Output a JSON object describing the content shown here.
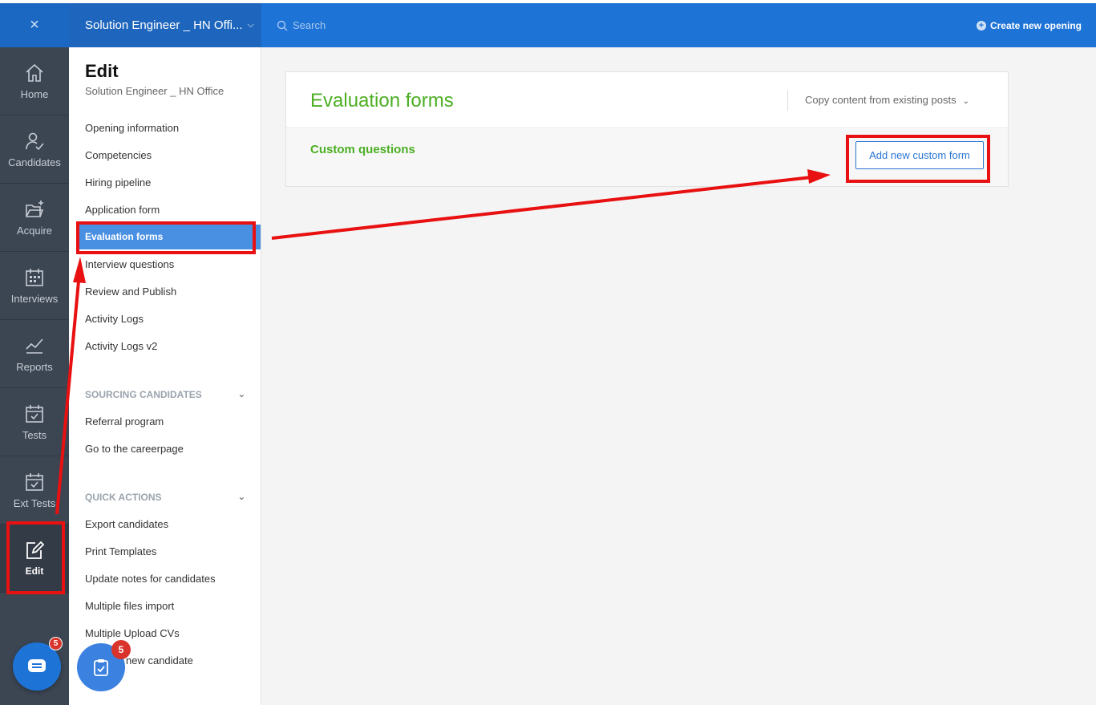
{
  "header": {
    "close_icon": "×",
    "job_title": "Solution Engineer _ HN Offi...",
    "search_placeholder": "Search",
    "create_label": "Create new opening"
  },
  "rail": {
    "items": [
      {
        "label": "Home",
        "icon": "home-icon"
      },
      {
        "label": "Candidates",
        "icon": "candidates-icon"
      },
      {
        "label": "Acquire",
        "icon": "folder-plus-icon"
      },
      {
        "label": "Interviews",
        "icon": "calendar-icon"
      },
      {
        "label": "Reports",
        "icon": "chart-line-icon"
      },
      {
        "label": "Tests",
        "icon": "calendar-check-icon"
      },
      {
        "label": "Ext Tests",
        "icon": "calendar-check-icon"
      },
      {
        "label": "Edit",
        "icon": "edit-icon",
        "active": true
      }
    ]
  },
  "menu": {
    "title": "Edit",
    "subtitle": "Solution Engineer _ HN Office",
    "items": [
      "Opening information",
      "Competencies",
      "Hiring pipeline",
      "Application form",
      "Evaluation forms",
      "Interview questions",
      "Review and Publish",
      "Activity Logs",
      "Activity Logs v2"
    ],
    "active_item": "Evaluation forms",
    "section_sourcing": "SOURCING CANDIDATES",
    "sourcing_items": [
      "Referral program",
      "Go to the careerpage"
    ],
    "section_quick": "QUICK ACTIONS",
    "quick_items": [
      "Export candidates",
      "Print Templates",
      "Update notes for candidates",
      "Multiple files import",
      "Multiple Upload CVs",
      "new candidate"
    ]
  },
  "main": {
    "title": "Evaluation forms",
    "copy_label": "Copy content from existing posts",
    "custom_questions": "Custom questions",
    "add_button": "Add new custom form"
  },
  "badges": {
    "chat_count": "5",
    "task_count": "5"
  },
  "colors": {
    "topbar": "#1d73d6",
    "rail": "#3c4653",
    "accent_green": "#4caf24",
    "active_menu": "#4a90e2",
    "annotation_red": "#e81010"
  }
}
